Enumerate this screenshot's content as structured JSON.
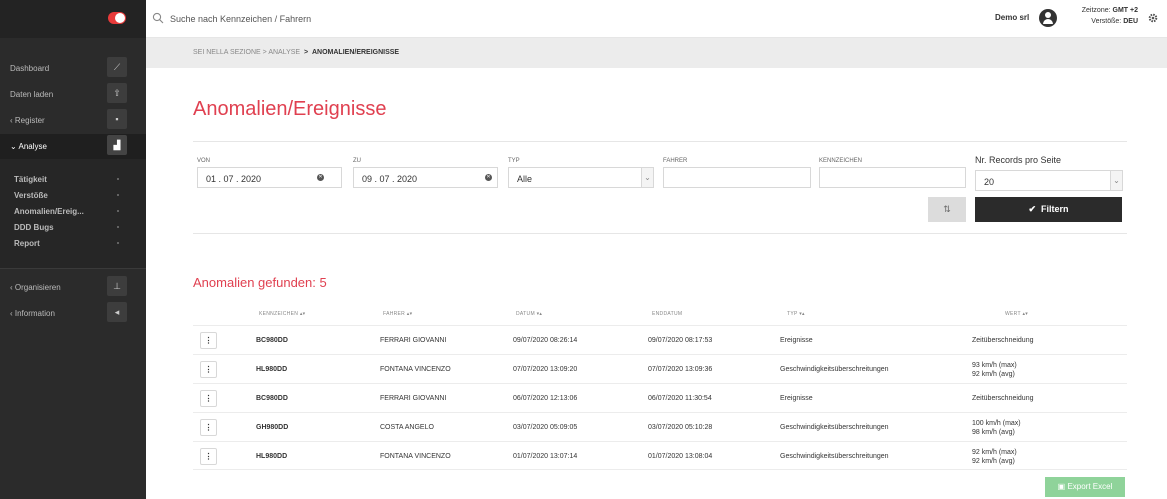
{
  "topbar": {
    "search_placeholder": "Suche nach Kennzeichen / Fahrern",
    "user_name": "Demo srl",
    "zone_label": "Zeitzone:",
    "zone_value": "GMT +2",
    "violations_label": "Verstöße:",
    "violations_value": "DEU"
  },
  "sidebar": {
    "items": [
      {
        "label": "Dashboard",
        "icon": "chart-icon"
      },
      {
        "label": "Daten laden",
        "icon": "upload-icon"
      },
      {
        "label": "‹  Register",
        "icon": "book-icon"
      },
      {
        "label": "⌄  Analyse",
        "icon": "bars-icon"
      },
      {
        "label": "‹  Organisieren",
        "icon": "sitemap-icon"
      },
      {
        "label": "‹  Information",
        "icon": "megaphone-icon"
      }
    ],
    "submenu": [
      "Tätigkeit",
      "Verstöße",
      "Anomalien/Ereig...",
      "DDD Bugs",
      "Report"
    ]
  },
  "breadcrumb": {
    "prefix": "SEI NELLA SEZIONE",
    "section": "ANALYSE",
    "current": "ANOMALIEN/EREIGNISSE"
  },
  "page": {
    "title": "Anomalien/Ereignisse"
  },
  "filters": {
    "von_label": "VON",
    "von_value": "01 . 07 . 2020",
    "zu_label": "ZU",
    "zu_value": "09 . 07 . 2020",
    "typ_label": "TYP",
    "typ_value": "Alle",
    "fahrer_label": "FAHRER",
    "fahrer_value": "",
    "kennzeichen_label": "KENNZEICHEN",
    "kennzeichen_value": "",
    "records_label": "Nr. Records pro Seite",
    "records_value": "20",
    "filter_button": "Filtern"
  },
  "results": {
    "found_label": "Anomalien gefunden: 5",
    "columns": [
      "KENNZEICHEN",
      "FAHRER",
      "DATUM",
      "ENDDATUM",
      "TYP",
      "WERT"
    ],
    "rows": [
      {
        "kennzeichen": "BC980DD",
        "fahrer": "FERRARI GIOVANNI",
        "datum": "09/07/2020 08:26:14",
        "enddatum": "09/07/2020 08:17:53",
        "typ": "Ereignisse",
        "wert1": "Zeitüberschneidung",
        "wert2": ""
      },
      {
        "kennzeichen": "HL980DD",
        "fahrer": "FONTANA VINCENZO",
        "datum": "07/07/2020 13:09:20",
        "enddatum": "07/07/2020 13:09:36",
        "typ": "Geschwindigkeitsüberschreitungen",
        "wert1": "93 km/h (max)",
        "wert2": "92 km/h (avg)"
      },
      {
        "kennzeichen": "BC980DD",
        "fahrer": "FERRARI GIOVANNI",
        "datum": "06/07/2020 12:13:06",
        "enddatum": "06/07/2020 11:30:54",
        "typ": "Ereignisse",
        "wert1": "Zeitüberschneidung",
        "wert2": ""
      },
      {
        "kennzeichen": "GH980DD",
        "fahrer": "COSTA ANGELO",
        "datum": "03/07/2020 05:09:05",
        "enddatum": "03/07/2020 05:10:28",
        "typ": "Geschwindigkeitsüberschreitungen",
        "wert1": "100 km/h (max)",
        "wert2": "98 km/h (avg)"
      },
      {
        "kennzeichen": "HL980DD",
        "fahrer": "FONTANA VINCENZO",
        "datum": "01/07/2020 13:07:14",
        "enddatum": "01/07/2020 13:08:04",
        "typ": "Geschwindigkeitsüberschreitungen",
        "wert1": "92 km/h (max)",
        "wert2": "92 km/h (avg)"
      }
    ],
    "row_menu_glyph": "⋮",
    "export_button": "Export Excel"
  },
  "colors": {
    "accent": "#e04050",
    "sidebar_bg": "#2b2b2b",
    "export_green": "#8fd39a"
  }
}
